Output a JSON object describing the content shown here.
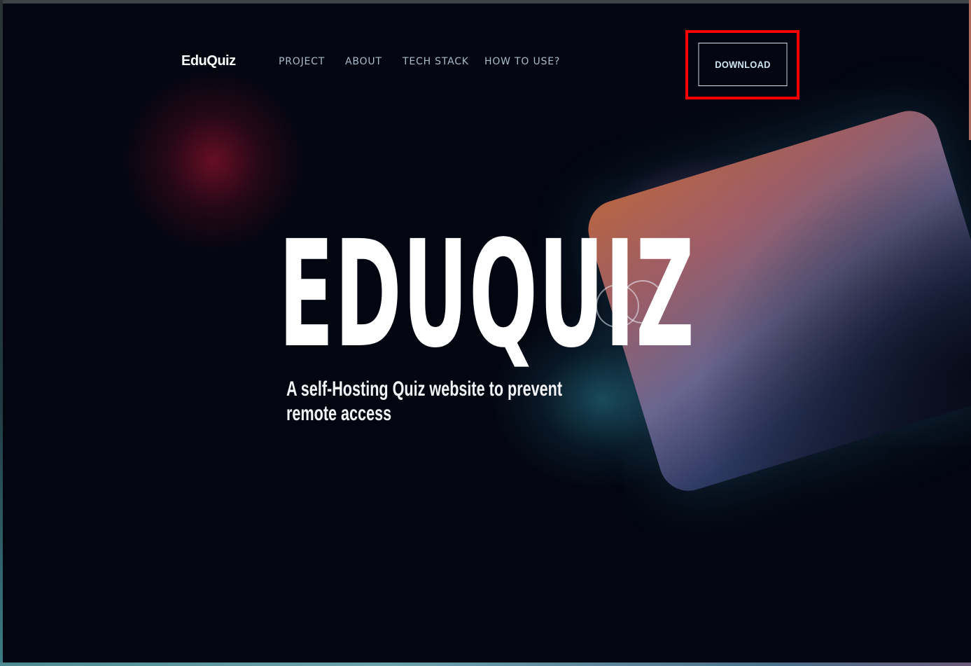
{
  "nav": {
    "brand": "EduQuiz",
    "links": [
      "PROJECT",
      "ABOUT",
      "TECH STACK",
      "HOW TO USE?"
    ],
    "download_label": "DOWNLOAD"
  },
  "hero": {
    "title": "EDUQUIZ",
    "subtitle_line1": "A self-Hosting Quiz website to prevent",
    "subtitle_line2": "remote access"
  },
  "colors": {
    "background": "#030611",
    "highlight_outline": "#ff0000",
    "nav_link": "#a9bccb",
    "title": "#ffffff"
  },
  "icons": [
    "overlapping-rings-icon"
  ]
}
